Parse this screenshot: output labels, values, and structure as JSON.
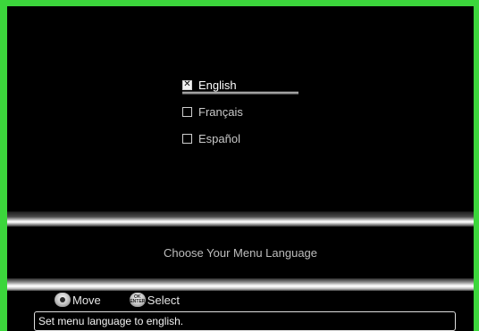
{
  "languages": [
    {
      "label": "English",
      "checked": true,
      "selected": true
    },
    {
      "label": "Français",
      "checked": false,
      "selected": false
    },
    {
      "label": "Español",
      "checked": false,
      "selected": false
    }
  ],
  "message": "Choose Your Menu Language",
  "hints": {
    "move_label": "Move",
    "select_label": "Select",
    "ok_icon_text": "OK ENTER"
  },
  "status": "Set menu language to english.",
  "colors": {
    "frame_border": "#3cd63c",
    "background": "#000000",
    "text": "#c9c9c9"
  },
  "icons": {
    "checked": "x-checkbox-icon",
    "unchecked": "empty-checkbox-icon",
    "move": "dpad-icon",
    "select": "ok-enter-icon"
  }
}
